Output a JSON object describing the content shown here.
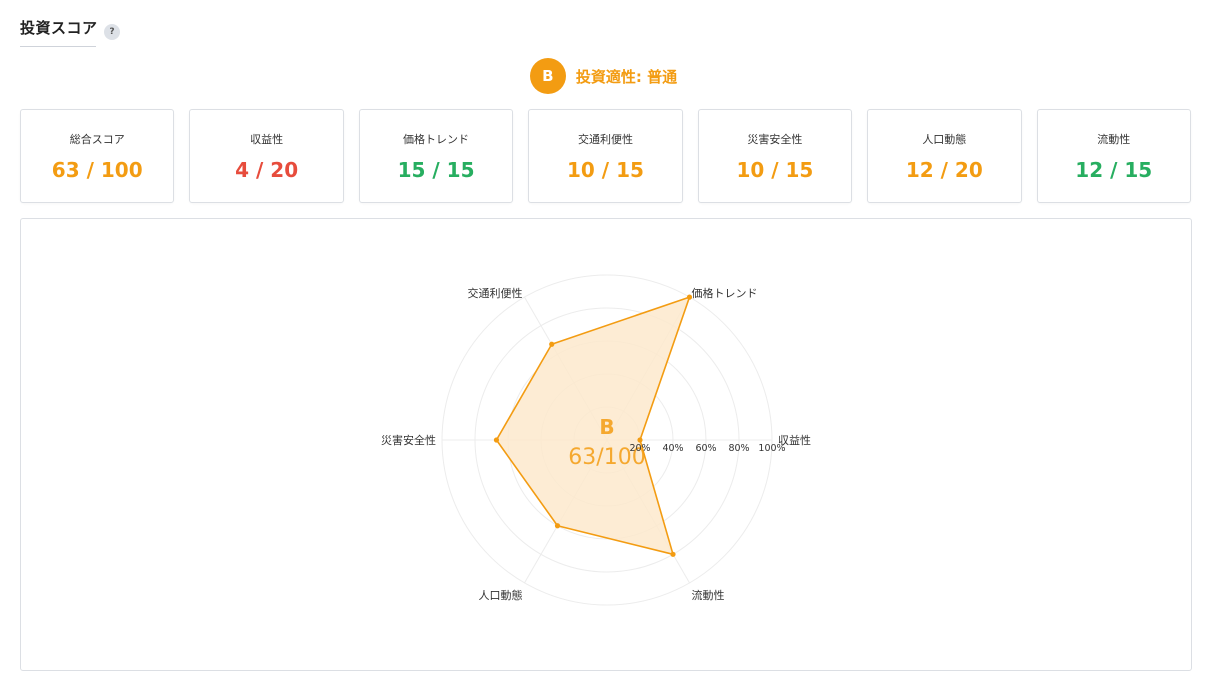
{
  "header": {
    "title": "投資スコア",
    "help_icon": "?"
  },
  "grade": {
    "letter": "B",
    "label": "投資適性: 普通",
    "color": "#f39c12"
  },
  "cards": [
    {
      "label": "総合スコア",
      "value": "63 / 100",
      "color": "#f39c12"
    },
    {
      "label": "収益性",
      "value": "4 / 20",
      "color": "#e74c3c"
    },
    {
      "label": "価格トレンド",
      "value": "15 / 15",
      "color": "#27ae60"
    },
    {
      "label": "交通利便性",
      "value": "10 / 15",
      "color": "#f39c12"
    },
    {
      "label": "災害安全性",
      "value": "10 / 15",
      "color": "#f39c12"
    },
    {
      "label": "人口動態",
      "value": "12 / 20",
      "color": "#f39c12"
    },
    {
      "label": "流動性",
      "value": "12 / 15",
      "color": "#27ae60"
    }
  ],
  "chart_data": {
    "type": "radar",
    "axes": [
      "収益性",
      "価格トレンド",
      "交通利便性",
      "災害安全性",
      "人口動態",
      "流動性"
    ],
    "values": [
      20,
      100,
      67,
      67,
      60,
      80
    ],
    "unit": "%",
    "rticks": [
      "20%",
      "40%",
      "60%",
      "80%",
      "100%"
    ],
    "rmax": 100,
    "center_grade": "B",
    "center_score": "63/100",
    "line_color": "#f39c12",
    "fill_color": "#fde9cc",
    "grid": true
  }
}
